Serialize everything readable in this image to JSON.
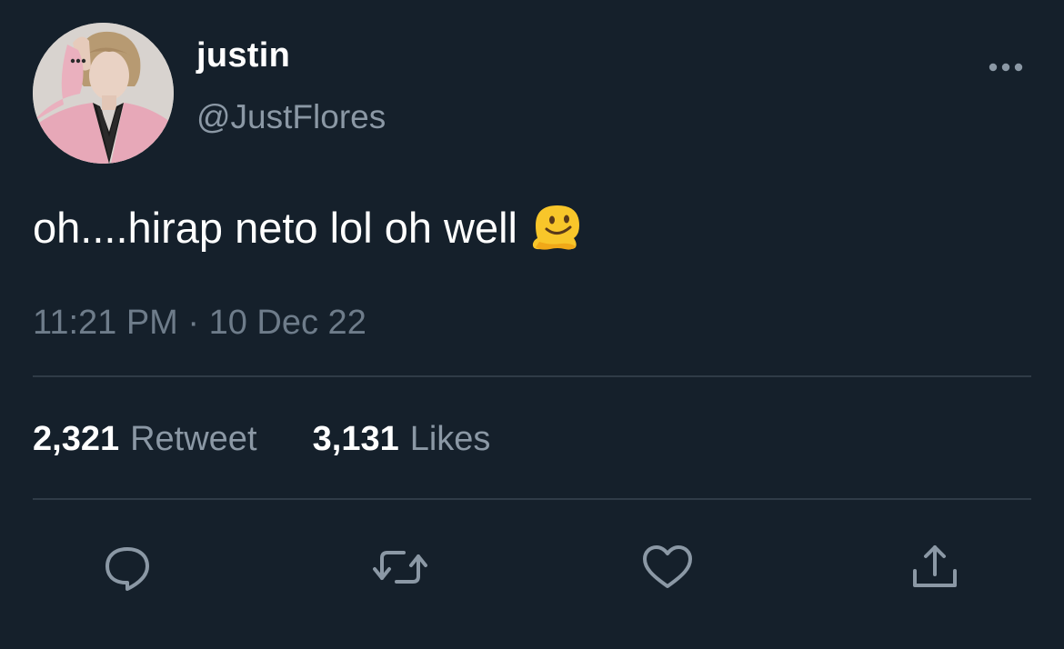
{
  "tweet": {
    "display_name": "justin",
    "handle": "@JustFlores",
    "text": "oh....hirap neto lol oh well",
    "emoji_icon": "melting-face-emoji",
    "timestamp": "11:21 PM · 10 Dec 22",
    "retweet_count": "2,321",
    "retweet_label": "Retweet",
    "likes_count": "3,131",
    "likes_label": "Likes"
  },
  "actions": [
    {
      "icon": "reply-icon"
    },
    {
      "icon": "retweet-icon"
    },
    {
      "icon": "like-icon"
    },
    {
      "icon": "share-icon"
    }
  ],
  "colors": {
    "background": "#15202b",
    "text_primary": "#ffffff",
    "text_secondary": "#8b98a5",
    "divider": "#2f3b47",
    "icon": "#8b98a5"
  }
}
